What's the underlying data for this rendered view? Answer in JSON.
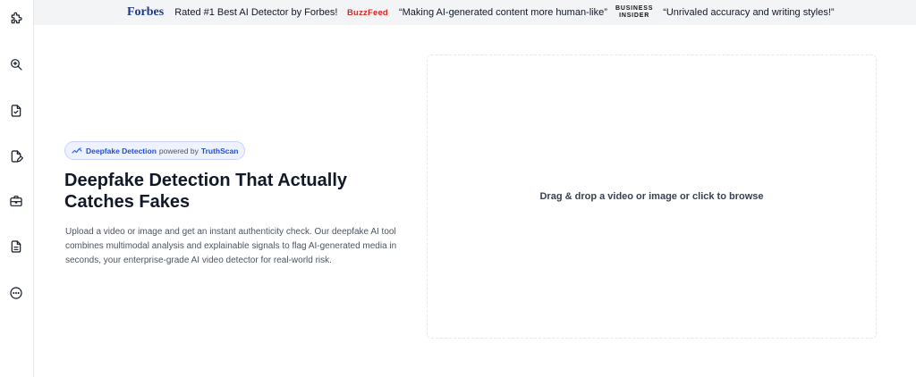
{
  "press": [
    {
      "logo": "Forbes",
      "quote": "Rated #1 Best AI Detector by Forbes!"
    },
    {
      "logo": "BuzzFeed",
      "quote": "“Making AI-generated content more human-like”"
    },
    {
      "logo_line1": "BUSINESS",
      "logo_line2": "INSIDER",
      "quote": "“Unrivaled accuracy and writing styles!”"
    }
  ],
  "sidebar": {
    "icons": [
      "puzzle-icon",
      "search-zoom-icon",
      "document-check-icon",
      "document-edit-icon",
      "briefcase-icon",
      "document-text-icon",
      "more-icon"
    ]
  },
  "hero": {
    "badge_feature": "Deepfake Detection",
    "badge_powered": "powered by",
    "badge_brand": "TruthScan",
    "headline": "Deepfake Detection That Actually Catches Fakes",
    "description": "Upload a video or image and get an instant authenticity check. Our deepfake AI tool combines multimodal analysis and explainable signals to flag AI-generated media in seconds, your enterprise-grade AI video detector for real-world risk."
  },
  "dropzone": {
    "label": "Drag & drop a video or image or click to browse"
  },
  "colors": {
    "accent": "#1d4ed8",
    "forbes": "#1e3a8a",
    "buzzfeed": "#dc2626"
  }
}
